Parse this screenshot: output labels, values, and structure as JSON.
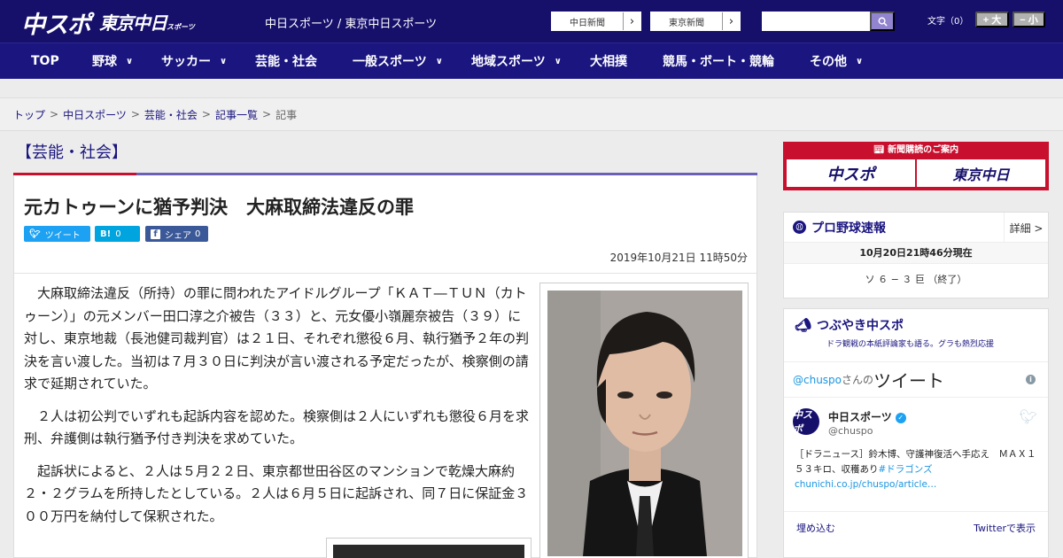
{
  "header": {
    "logo_chuspo": "中スポ",
    "logo_tokyo": "東京中日",
    "logo_tokyo_small": "スポーツ",
    "site_name": "中日スポーツ / 東京中日スポーツ",
    "btn_chunichi": "中日新聞",
    "btn_tokyo": "東京新聞",
    "search_placeholder": "",
    "font_size_label": "文字（0）",
    "font_bigger": "+ 大",
    "font_smaller": "− 小"
  },
  "nav": [
    {
      "label": "TOP",
      "dropdown": false
    },
    {
      "label": "野球",
      "dropdown": true
    },
    {
      "label": "サッカー",
      "dropdown": true
    },
    {
      "label": "芸能・社会",
      "dropdown": false
    },
    {
      "label": "一般スポーツ",
      "dropdown": true
    },
    {
      "label": "地域スポーツ",
      "dropdown": true
    },
    {
      "label": "大相撲",
      "dropdown": false
    },
    {
      "label": "競馬・ボート・競輪",
      "dropdown": false
    },
    {
      "label": "その他",
      "dropdown": true
    }
  ],
  "breadcrumb": [
    "トップ",
    "中日スポーツ",
    "芸能・社会",
    "記事一覧",
    "記事"
  ],
  "category": "【芸能・社会】",
  "article": {
    "title": "元カトゥーンに猶予判決　大麻取締法違反の罪",
    "tweet_label": "ツイート",
    "hatena_label": "B!",
    "hatena_count": "0",
    "share_label": "シェア",
    "share_count": "0",
    "date": "2019年10月21日 11時50分",
    "paragraphs": [
      "大麻取締法違反（所持）の罪に問われたアイドルグループ「ＫＡＴ―ＴＵＮ（カトゥーン）」の元メンバー田口淳之介被告（３３）と、元女優小嶺麗奈被告（３９）に対し、東京地裁（長池健司裁判官）は２１日、それぞれ懲役６月、執行猶予２年の判決を言い渡した。当初は７月３０日に判決が言い渡される予定だったが、検察側の請求で延期されていた。",
      "２人は初公判でいずれも起訴内容を認めた。検察側は２人にいずれも懲役６月を求刑、弁護側は執行猶予付き判決を求めていた。",
      "起訴状によると、２人は５月２２日、東京都世田谷区のマンションで乾燥大麻約２・２グラムを所持したとしている。２人は６月５日に起訴され、同７日に保証金３００万円を納付して保釈された。"
    ]
  },
  "sidebar": {
    "subscribe_title": "新聞購読のご案内",
    "subscribe_chuspo": "中スポ",
    "subscribe_tokyo": "東京中日",
    "baseball": {
      "title": "プロ野球速報",
      "detail": "詳細 >",
      "time": "10月20日21時46分現在",
      "result": "ソ ６ − ３ 巨 （終了）"
    },
    "tsubuyaki": {
      "title": "つぶやき中スポ",
      "subtitle": "ドラ観戦の本紙評論家も語る。グラも熱烈応援"
    },
    "twitter": {
      "handle_link": "@chuspo",
      "san": "さんの",
      "tweets": "ツイート",
      "user": "中日スポーツ",
      "user_handle": "@chuspo",
      "avatar": "中スポ",
      "text": "［ドラニュース］鈴木博、守護神復活へ手応え　ＭＡＸ１５３キロ、収穫あり",
      "hashtag": "#ドラゴンズ",
      "link": "chunichi.co.jp/chuspo/article…",
      "embed": "埋め込む",
      "view_on": "Twitterで表示"
    }
  },
  "colors": {
    "header": "#16106b",
    "nav": "#1a157f",
    "accent_red": "#c8102e",
    "twitter": "#1da1f2"
  }
}
